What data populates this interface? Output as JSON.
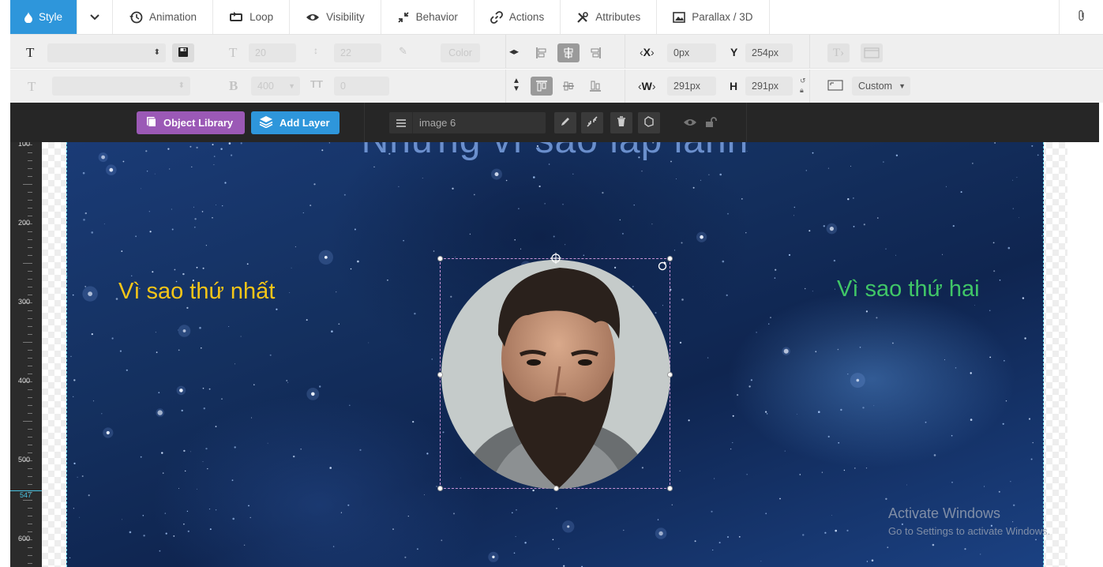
{
  "tabs": [
    {
      "label": "Style",
      "icon": "drop-icon",
      "active": true
    },
    {
      "label": "Animation",
      "icon": "history-icon"
    },
    {
      "label": "Loop",
      "icon": "loop-icon"
    },
    {
      "label": "Visibility",
      "icon": "eye-icon"
    },
    {
      "label": "Behavior",
      "icon": "behavior-icon"
    },
    {
      "label": "Actions",
      "icon": "link-icon"
    },
    {
      "label": "Attributes",
      "icon": "tools-icon"
    },
    {
      "label": "Parallax / 3D",
      "icon": "image-icon"
    }
  ],
  "toolbar": {
    "font_size": "20",
    "line_height": "22",
    "color_placeholder": "Color",
    "font_weight": "400",
    "letter_spacing": "0",
    "x_label": "X",
    "x_value": "0px",
    "y_label": "Y",
    "y_value": "254px",
    "w_label": "W",
    "w_value": "291px",
    "h_label": "H",
    "h_value": "291px",
    "size_mode": "Custom"
  },
  "layerbar": {
    "object_library": "Object Library",
    "add_layer": "Add Layer",
    "layer_name": "image 6"
  },
  "ruler": {
    "labels": [
      "100",
      "200",
      "300",
      "400",
      "500",
      "600"
    ],
    "marker": "547"
  },
  "canvas": {
    "heading": "Những vì sao lấp lánh",
    "text_left": "Vì sao thứ nhất",
    "text_right": "Vì sao thứ hai",
    "text_left_color": "#f5c518",
    "text_right_color": "#40c667"
  },
  "watermark": {
    "line1": "Activate Windows",
    "line2": "Go to Settings to activate Windows."
  },
  "colors": {
    "accent": "#2e96db",
    "library": "#9b59b6",
    "toolbar_dark": "#262626"
  }
}
